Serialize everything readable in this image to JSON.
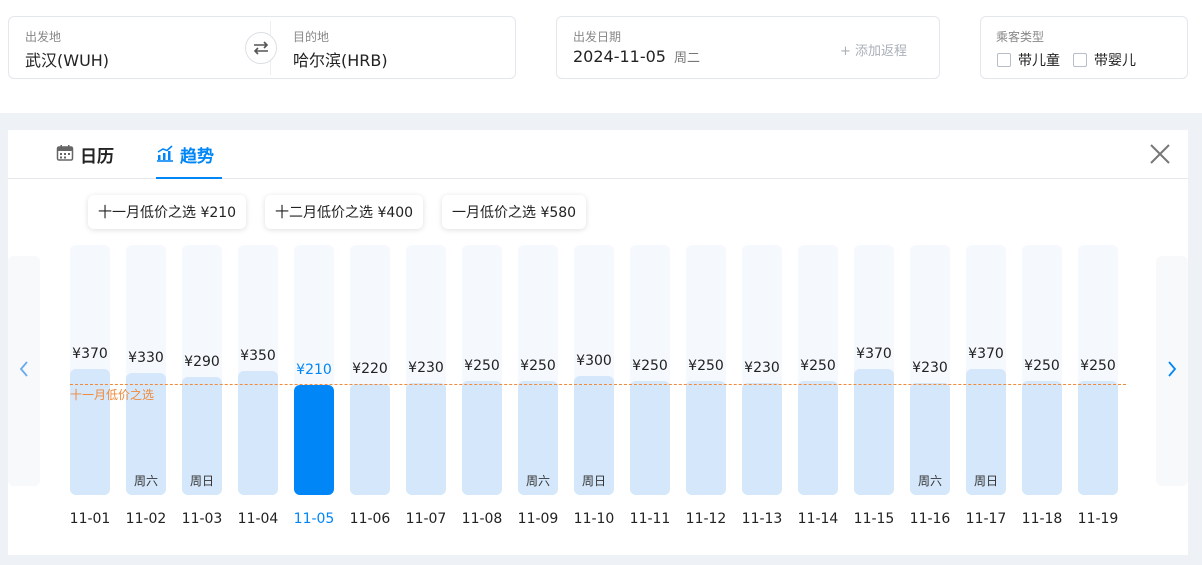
{
  "search": {
    "from_label": "出发地",
    "from_value": "武汉(WUH)",
    "to_label": "目的地",
    "to_value": "哈尔滨(HRB)",
    "date_label": "出发日期",
    "date_value": "2024-11-05",
    "date_weekday": "周二",
    "add_return": "+ 添加返程",
    "passenger_label": "乘客类型",
    "child_label": "带儿童",
    "infant_label": "带婴儿"
  },
  "tabs": [
    {
      "label": "日历",
      "icon": "calendar-icon",
      "active": false
    },
    {
      "label": "趋势",
      "icon": "trend-chart-icon",
      "active": true
    }
  ],
  "tips": [
    "十一月低价之选 ¥210",
    "十二月低价之选 ¥400",
    "一月低价之选 ¥580"
  ],
  "low_line_label": "十一月低价之选",
  "colors": {
    "accent": "#0086f6",
    "bar": "#d4e7fb",
    "low_line": "#f08a3a"
  },
  "chart_data": {
    "type": "bar",
    "currency": "¥",
    "categories": [
      "11-01",
      "11-02",
      "11-03",
      "11-04",
      "11-05",
      "11-06",
      "11-07",
      "11-08",
      "11-09",
      "11-10",
      "11-11",
      "11-12",
      "11-13",
      "11-14",
      "11-15",
      "11-16",
      "11-17",
      "11-18",
      "11-19"
    ],
    "values": [
      370,
      330,
      290,
      350,
      210,
      220,
      230,
      250,
      250,
      300,
      250,
      250,
      230,
      250,
      370,
      230,
      370,
      250,
      250
    ],
    "weekend_labels": [
      "",
      "周六",
      "周日",
      "",
      "",
      "",
      "",
      "",
      "周六",
      "周日",
      "",
      "",
      "",
      "",
      "",
      "周六",
      "周日",
      "",
      ""
    ],
    "selected": "11-05",
    "low_price_reference": 210
  }
}
